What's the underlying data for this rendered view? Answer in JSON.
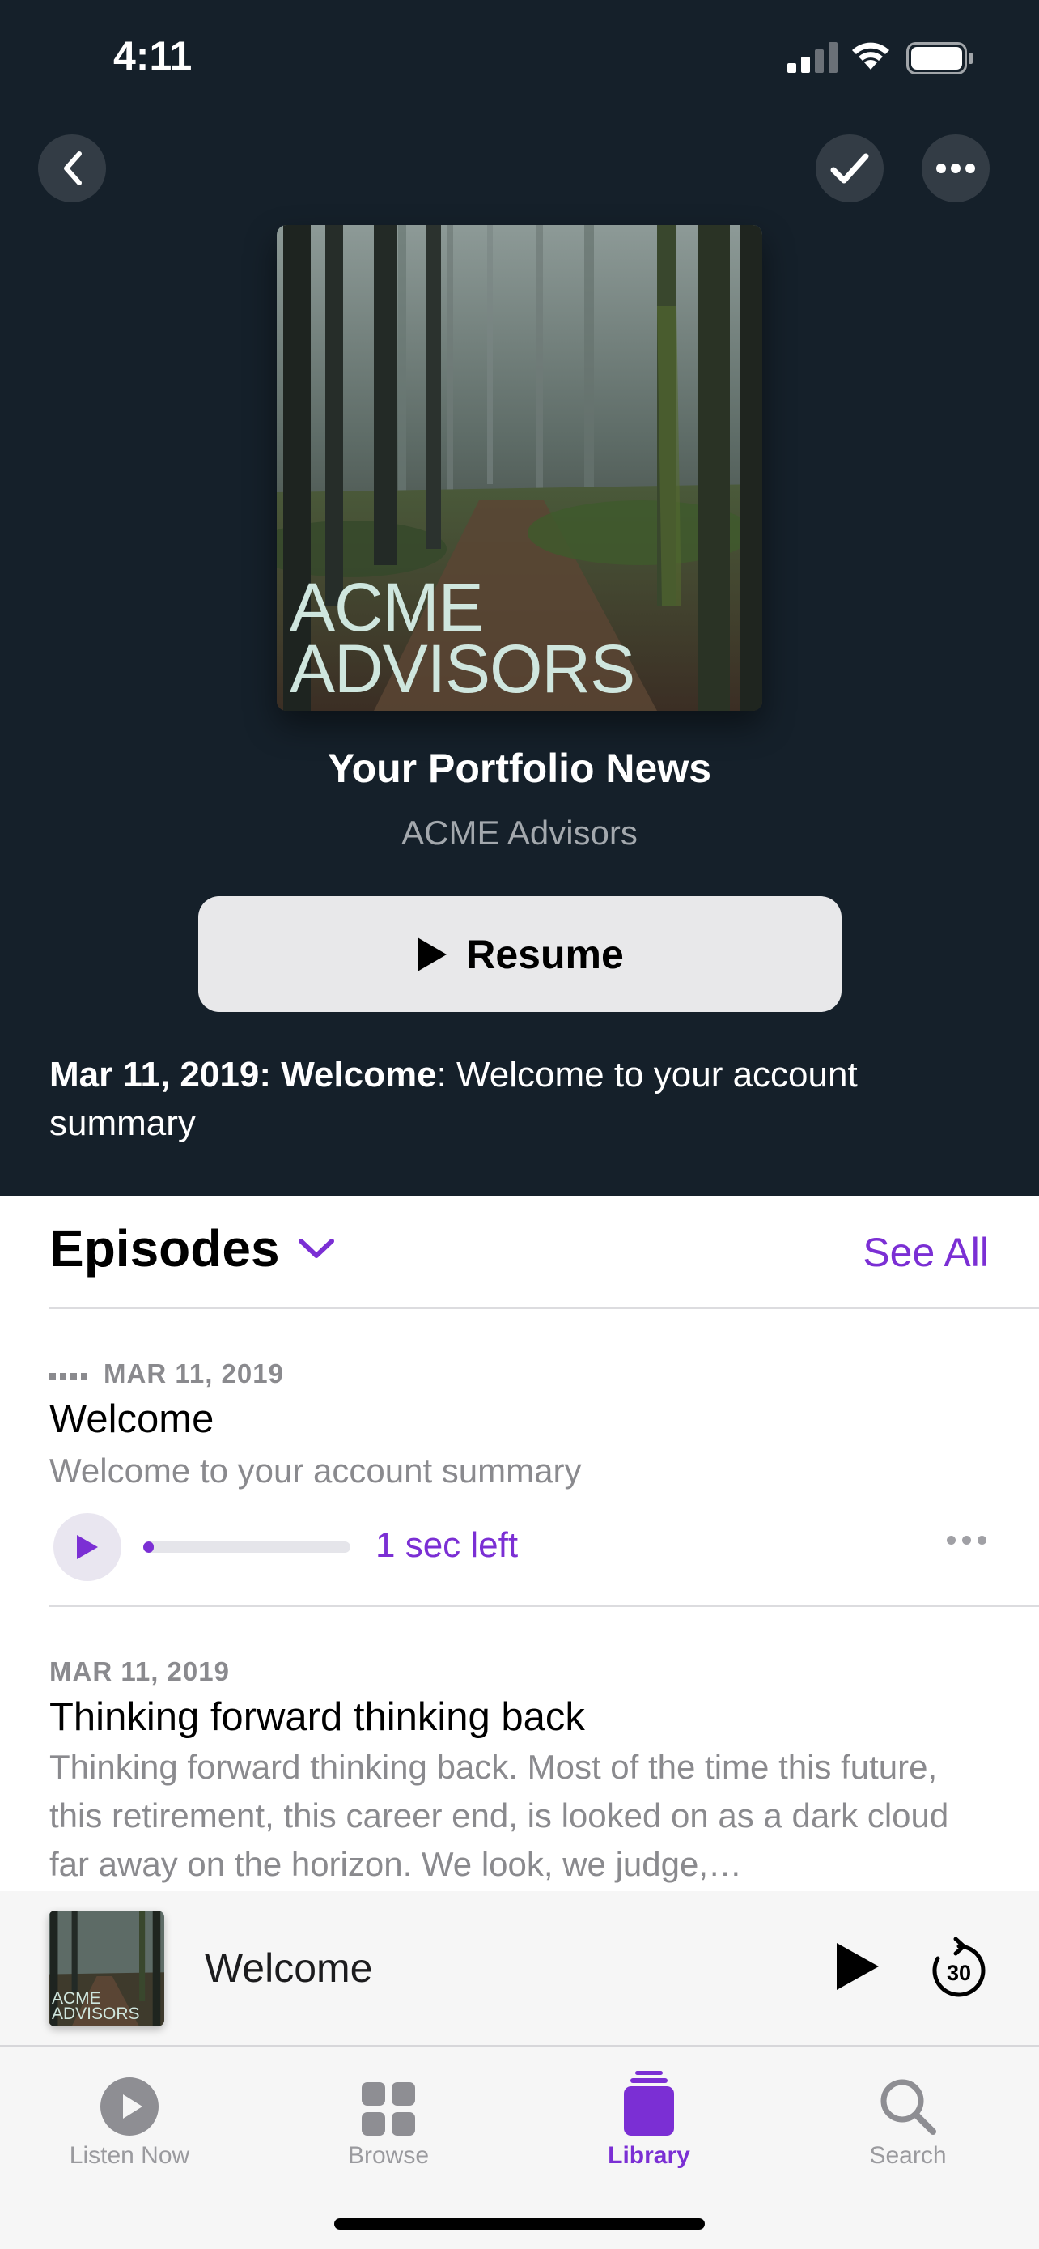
{
  "status_bar": {
    "time": "4:11"
  },
  "header": {
    "back_icon": "chevron-left-icon",
    "check_icon": "checkmark-icon",
    "more_icon": "ellipsis-icon"
  },
  "podcast": {
    "artwork_text_line1": "ACME",
    "artwork_text_line2": "ADVISORS",
    "title": "Your Portfolio News",
    "author": "ACME Advisors",
    "resume_label": "Resume",
    "description_date_title": "Mar 11, 2019: Welcome",
    "description_rest": ": Welcome to your account summary"
  },
  "episodes_section": {
    "heading": "Episodes",
    "see_all": "See All",
    "items": [
      {
        "date": "MAR 11, 2019",
        "title": "Welcome",
        "subtitle": "Welcome to your account summary",
        "time_left": "1 sec left",
        "progress": 0.05
      },
      {
        "date": "MAR 11, 2019",
        "title": "Thinking forward thinking back",
        "subtitle": "Thinking forward thinking back. Most of the time this future, this retirement, this career end, is looked on as a dark cloud far away on the horizon. We look, we judge,…"
      }
    ]
  },
  "mini_player": {
    "art_line1": "ACME",
    "art_line2": "ADVISORS",
    "title": "Welcome",
    "skip_label": "30"
  },
  "tab_bar": {
    "tabs": [
      {
        "label": "Listen Now",
        "icon": "play-circle-icon"
      },
      {
        "label": "Browse",
        "icon": "grid-icon"
      },
      {
        "label": "Library",
        "icon": "library-stack-icon",
        "active": true
      },
      {
        "label": "Search",
        "icon": "magnifier-icon"
      }
    ]
  },
  "colors": {
    "accent": "#7b2fd4",
    "header_bg": "#15202a"
  }
}
